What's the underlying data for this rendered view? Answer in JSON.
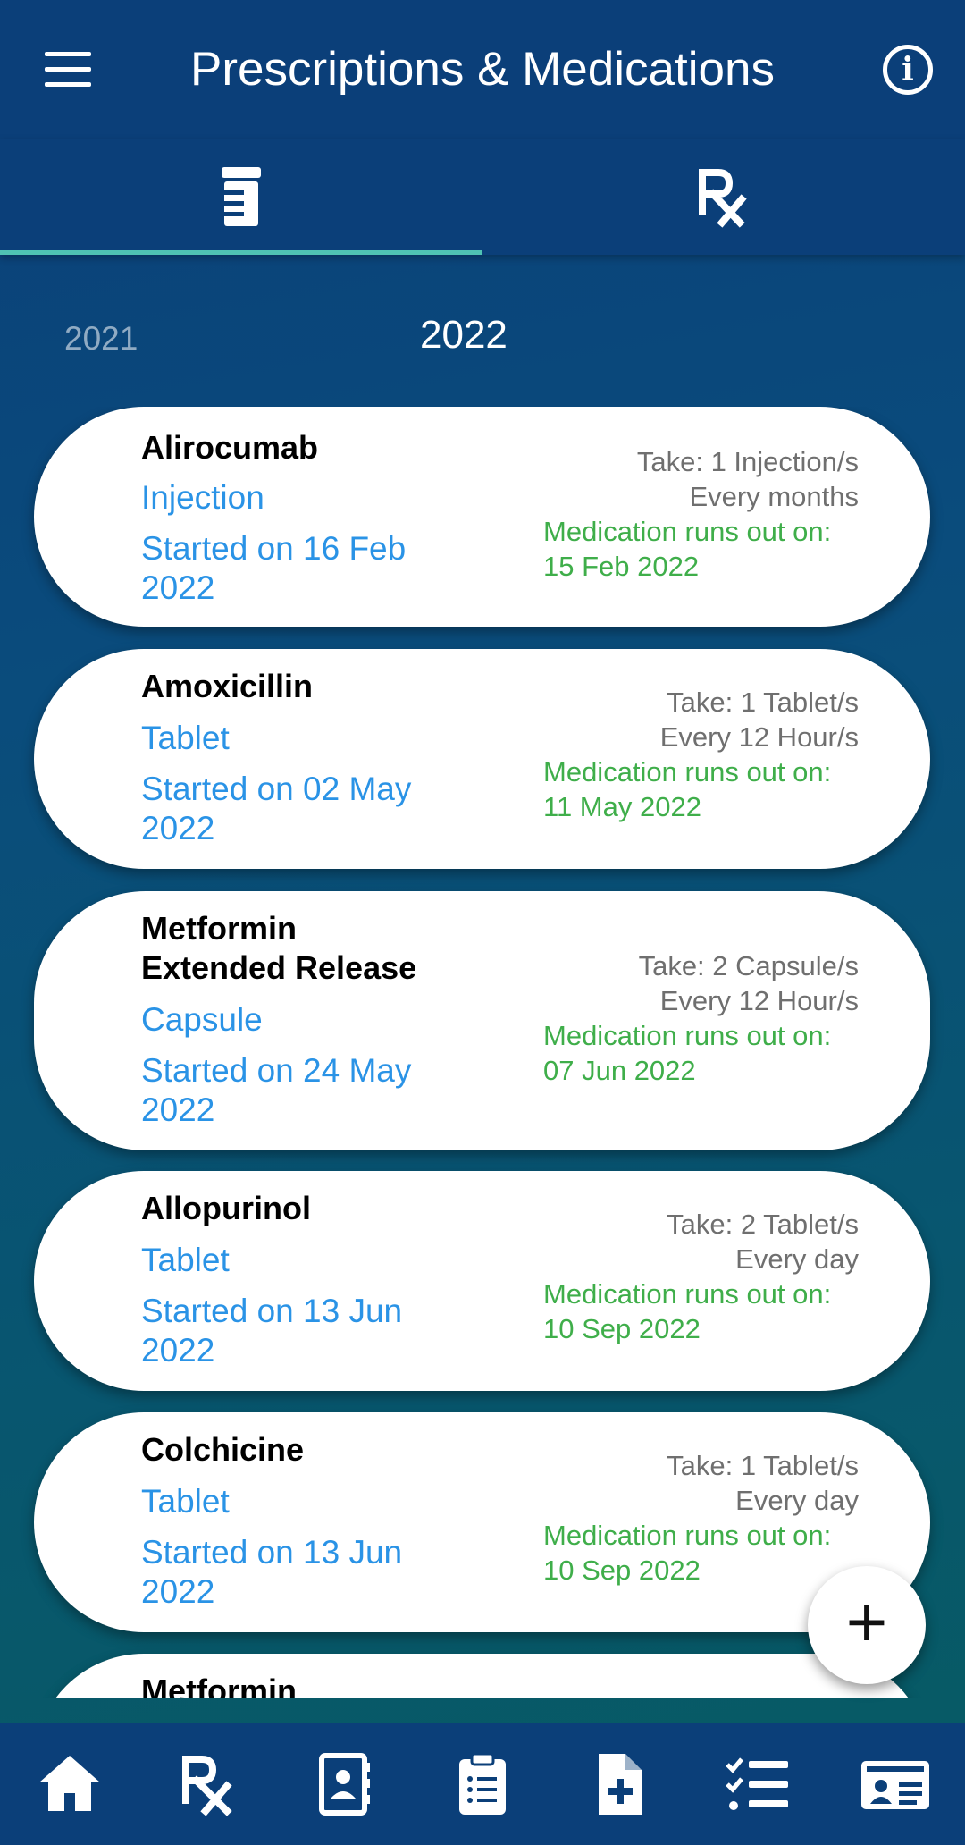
{
  "app": {
    "title": "Prescriptions & Medications",
    "menu_icon": "hamburger-menu-icon",
    "info_icon": "info-icon"
  },
  "tabs": [
    {
      "icon": "pill-bottle-icon",
      "selected": true
    },
    {
      "icon": "rx-icon",
      "selected": false
    }
  ],
  "years": {
    "previous": "2021",
    "current": "2022"
  },
  "medications": [
    {
      "name": "Alirocumab",
      "form": "Injection",
      "started": "Started on 16 Feb 2022",
      "take": "Take: 1 Injection/s",
      "frequency": "Every months",
      "runs_out_label": "Medication runs out on:",
      "runs_out_date": "15 Feb 2022"
    },
    {
      "name": "Amoxicillin",
      "form": "Tablet",
      "started": "Started on 02 May 2022",
      "take": "Take: 1 Tablet/s",
      "frequency": "Every 12 Hour/s",
      "runs_out_label": "Medication runs out on:",
      "runs_out_date": "11 May 2022"
    },
    {
      "name": "Metformin Extended Release",
      "form": "Capsule",
      "started": "Started on 24 May 2022",
      "take": "Take: 2 Capsule/s",
      "frequency": "Every 12 Hour/s",
      "runs_out_label": "Medication runs out on:",
      "runs_out_date": "07 Jun 2022"
    },
    {
      "name": "Allopurinol",
      "form": "Tablet",
      "started": "Started on 13 Jun 2022",
      "take": "Take: 2 Tablet/s",
      "frequency": "Every day",
      "runs_out_label": "Medication runs out on:",
      "runs_out_date": "10 Sep 2022"
    },
    {
      "name": "Colchicine",
      "form": "Tablet",
      "started": "Started on 13 Jun 2022",
      "take": "Take: 1 Tablet/s",
      "frequency": "Every day",
      "runs_out_label": "Medication runs out on:",
      "runs_out_date": "10 Sep 2022"
    },
    {
      "name": "Metformin"
    }
  ],
  "fab": {
    "label": "+",
    "icon": "add-icon"
  },
  "bottom_nav": [
    {
      "icon": "home-icon"
    },
    {
      "icon": "rx-icon"
    },
    {
      "icon": "contact-book-icon"
    },
    {
      "icon": "clipboard-list-icon"
    },
    {
      "icon": "medical-file-icon"
    },
    {
      "icon": "checklist-icon"
    },
    {
      "icon": "id-card-icon"
    }
  ],
  "colors": {
    "primary": "#0b3f79",
    "tab_indicator": "#4fc3b3",
    "link_blue": "#2a93e6",
    "green": "#3fae4a",
    "gray_text": "#6f6f6f"
  }
}
